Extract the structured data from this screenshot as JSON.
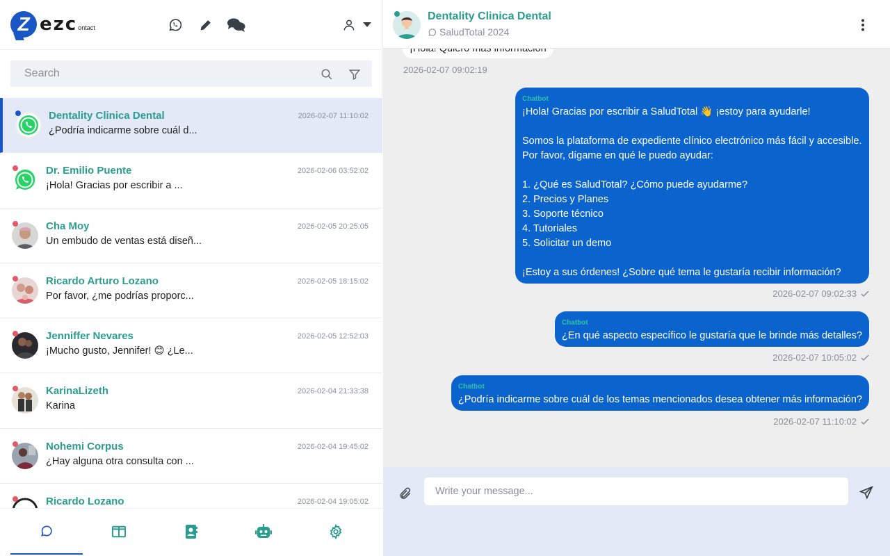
{
  "app": {
    "logo_text": "ezc",
    "logo_sub": "ontact",
    "logo_letter": "Z"
  },
  "topbar_icons": [
    "whatsapp-icon",
    "pencil-icon",
    "chats-icon",
    "user-icon"
  ],
  "search": {
    "placeholder": "Search"
  },
  "chats": [
    {
      "name": "Dentality Clinica Dental",
      "time": "2026-02-07 11:10:02",
      "preview": "¿Podría indicarme sobre cuál d...",
      "avatar": "whatsapp",
      "active": true
    },
    {
      "name": "Dr. Emilio Puente",
      "time": "2026-02-06 03:52:02",
      "preview": "¡Hola! Gracias por escribir a ...",
      "avatar": "whatsapp"
    },
    {
      "name": "Cha Moy",
      "time": "2026-02-05 20:25:05",
      "preview": "Un embudo de ventas está diseñ...",
      "avatar": "photo"
    },
    {
      "name": "Ricardo Arturo Lozano",
      "time": "2026-02-05 18:15:02",
      "preview": "Por favor, ¿me podrías proporc...",
      "avatar": "photo"
    },
    {
      "name": "Jenniffer Nevares",
      "time": "2026-02-05 12:52:03",
      "preview": "¡Mucho gusto, Jennifer! 😊 ¿Le...",
      "avatar": "photo"
    },
    {
      "name": "KarinaLizeth",
      "time": "2026-02-04 21:33:38",
      "preview": "Karina",
      "avatar": "photo"
    },
    {
      "name": "Nohemi Corpus",
      "time": "2026-02-04 19:45:02",
      "preview": "¿Hay alguna otra consulta con ...",
      "avatar": "photo"
    },
    {
      "name": "Ricardo Lozano",
      "time": "2026-02-04 19:05:02",
      "preview": "",
      "avatar": "photo"
    }
  ],
  "bottom_nav": [
    "chat-bubble-icon",
    "columns-icon",
    "contacts-icon",
    "robot-icon",
    "gear-icon"
  ],
  "conversation": {
    "contact_name": "Dentality Clinica Dental",
    "channel": "SaludTotal 2024",
    "incoming": {
      "text": "¡Hola! Quiero más información",
      "time": "2026-02-07 09:02:19"
    },
    "outgoing": [
      {
        "sender": "Chatbot",
        "text": "¡Hola! Gracias por escribir a SaludTotal 👋 ¡estoy para ayudarle!\n\nSomos la plataforma de expediente clínico electrónico más fácil y accesible.\nPor favor, dígame en qué le puedo ayudar:\n\n1. ¿Qué es SaludTotal? ¿Cómo puede ayudarme?\n2. Precios y Planes\n3. Soporte técnico\n4. Tutoriales\n5. Solicitar un demo\n\n¡Estoy a sus órdenes! ¿Sobre qué tema le gustaría recibir información?",
        "time": "2026-02-07 09:02:33"
      },
      {
        "sender": "Chatbot",
        "text": "¿En qué aspecto específico le gustaría que le brinde más detalles?",
        "time": "2026-02-07 10:05:02"
      },
      {
        "sender": "Chatbot",
        "text": "¿Podría indicarme sobre cuál de los temas mencionados desea obtener más información?",
        "time": "2026-02-07 11:10:02"
      }
    ]
  },
  "composer": {
    "placeholder": "Write your message..."
  },
  "colors": {
    "brand_blue": "#1a56c4",
    "teal_name": "#2a9d8f",
    "bubble_blue": "#0b63ce",
    "unread_dot": "#e05a6a",
    "whatsapp_green": "#25d366"
  }
}
